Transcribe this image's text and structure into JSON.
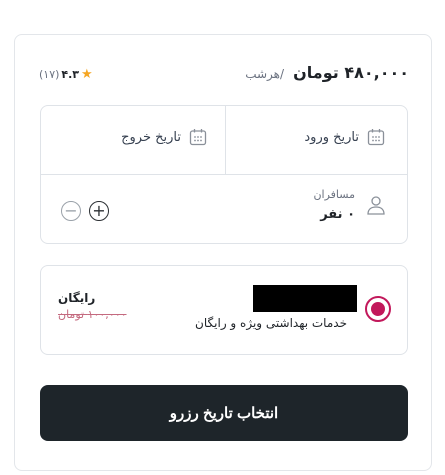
{
  "price": {
    "amount": "۴۸۰,۰۰۰ تومان",
    "per_night": "/هرشب"
  },
  "rating": {
    "score": "۴.۳",
    "count": "(۱۷)"
  },
  "booking": {
    "check_in_label": "تاریخ ورود",
    "check_out_label": "تاریخ خروج",
    "passengers_label": "مسافران",
    "passengers_value": "۰ نفر"
  },
  "service": {
    "description": "خدمات بهداشتی ویژه و رایگان",
    "price_label": "رایگان",
    "original_price": "۱۰۰,۰۰۰ تومان"
  },
  "cta": {
    "label": "انتخاب تاریخ رزرو"
  },
  "colors": {
    "accent": "#c2185b",
    "cta_bg": "#1e252a",
    "star": "#f5a623"
  }
}
